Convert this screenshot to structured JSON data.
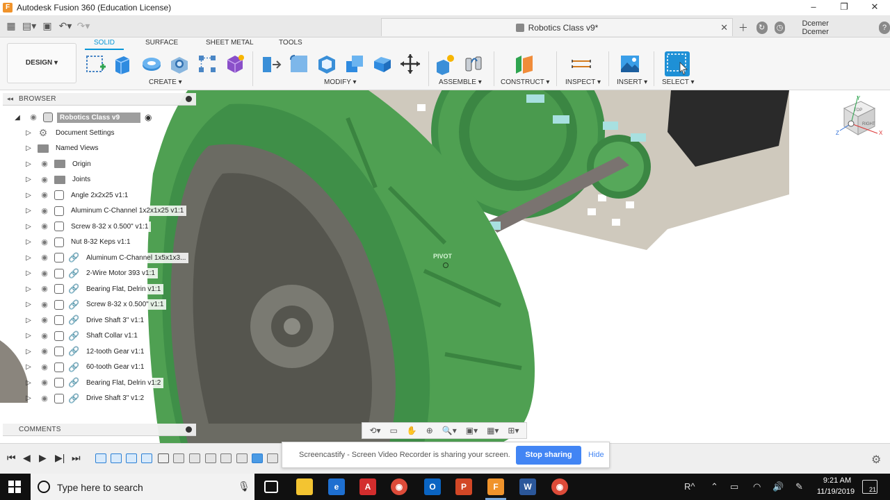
{
  "app": {
    "title": "Autodesk Fusion 360 (Education License)",
    "logo_letter": "F"
  },
  "document": {
    "tab_title": "Robotics Class v9*",
    "close": "✕"
  },
  "user": {
    "name": "Dcemer Dcemer"
  },
  "workspace": {
    "label": "DESIGN"
  },
  "ribbon_tabs": [
    "SOLID",
    "SURFACE",
    "SHEET METAL",
    "TOOLS"
  ],
  "ribbon_groups": {
    "create": "CREATE",
    "modify": "MODIFY",
    "assemble": "ASSEMBLE",
    "construct": "CONSTRUCT",
    "inspect": "INSPECT",
    "insert": "INSERT",
    "select": "SELECT"
  },
  "browser": {
    "title": "BROWSER",
    "root": "Robotics Class v9",
    "items": [
      {
        "label": "Document Settings",
        "kind": "gear"
      },
      {
        "label": "Named Views",
        "kind": "folder"
      },
      {
        "label": "Origin",
        "kind": "folder"
      },
      {
        "label": "Joints",
        "kind": "folder"
      },
      {
        "label": "Angle 2x2x25 v1:1",
        "kind": "component"
      },
      {
        "label": "Aluminum C-Channel 1x2x1x25 v1:1",
        "kind": "component"
      },
      {
        "label": "Screw 8-32 x 0.500\" v1:1",
        "kind": "component"
      },
      {
        "label": "Nut 8-32 Keps v1:1",
        "kind": "component"
      },
      {
        "label": "Aluminum C-Channel 1x5x1x3...",
        "kind": "linked"
      },
      {
        "label": "2-Wire Motor 393 v1:1",
        "kind": "linked"
      },
      {
        "label": "Bearing Flat, Delrin v1:1",
        "kind": "linked"
      },
      {
        "label": "Screw 8-32 x 0.500\" v1:1",
        "kind": "linked"
      },
      {
        "label": "Drive Shaft 3\" v1:1",
        "kind": "linked"
      },
      {
        "label": "Shaft Collar v1:1",
        "kind": "linked"
      },
      {
        "label": "12-tooth Gear v1:1",
        "kind": "linked"
      },
      {
        "label": "60-tooth Gear v1:1",
        "kind": "linked"
      },
      {
        "label": "Bearing Flat, Delrin v1:2",
        "kind": "linked"
      },
      {
        "label": "Drive Shaft 3\" v1:2",
        "kind": "linked"
      }
    ]
  },
  "comments": {
    "title": "COMMENTS"
  },
  "viewport": {
    "pivot_label": "PIVOT"
  },
  "viewcube": {
    "top": "TOP",
    "right": "RIGHT",
    "axis_x": "X",
    "axis_y": "Y",
    "axis_z": "Z"
  },
  "banner": {
    "text": "Screencastify - Screen Video Recorder is sharing your screen.",
    "stop": "Stop sharing",
    "hide": "Hide"
  },
  "taskbar": {
    "search_placeholder": "Type here to search",
    "time": "9:21 AM",
    "date": "11/19/2019",
    "notifications": "21",
    "tray_label": "R"
  },
  "colors": {
    "accent": "#0696d7",
    "wheel_green": "#4fa052",
    "tire_gray": "#6b6b63",
    "banner_blue": "#4285f4"
  }
}
